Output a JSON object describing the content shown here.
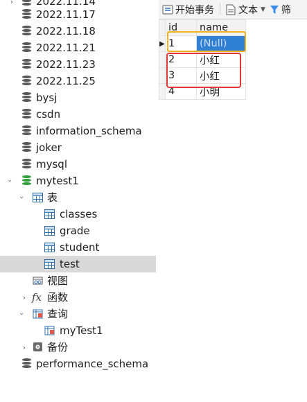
{
  "tree": {
    "items": [
      {
        "label": "2022.11.14"
      },
      {
        "label": "2022.11.17"
      },
      {
        "label": "2022.11.18"
      },
      {
        "label": "2022.11.21"
      },
      {
        "label": "2022.11.23"
      },
      {
        "label": "2022.11.25"
      },
      {
        "label": "bysj"
      },
      {
        "label": "csdn"
      },
      {
        "label": "information_schema"
      },
      {
        "label": "joker"
      },
      {
        "label": "mysql"
      },
      {
        "label": "mytest1"
      },
      {
        "label": "表"
      },
      {
        "label": "classes"
      },
      {
        "label": "grade"
      },
      {
        "label": "student"
      },
      {
        "label": "test"
      },
      {
        "label": "视图"
      },
      {
        "label": "函数"
      },
      {
        "label": "查询"
      },
      {
        "label": "myTest1"
      },
      {
        "label": "备份"
      },
      {
        "label": "performance_schema"
      }
    ],
    "selected": "test"
  },
  "toolbar": {
    "begin_transaction": "开始事务",
    "text": "文本",
    "filter": "筛"
  },
  "grid": {
    "columns": [
      "id",
      "name"
    ],
    "rows": [
      {
        "id": "1",
        "name": "(Null)"
      },
      {
        "id": "2",
        "name": "小红"
      },
      {
        "id": "3",
        "name": "小红"
      },
      {
        "id": "4",
        "name": "小明"
      }
    ]
  },
  "colors": {
    "selection": "#2f7fd3",
    "annotation_yellow": "#f2b21d",
    "annotation_red": "#e53535",
    "db_active": "#2fa13a"
  }
}
